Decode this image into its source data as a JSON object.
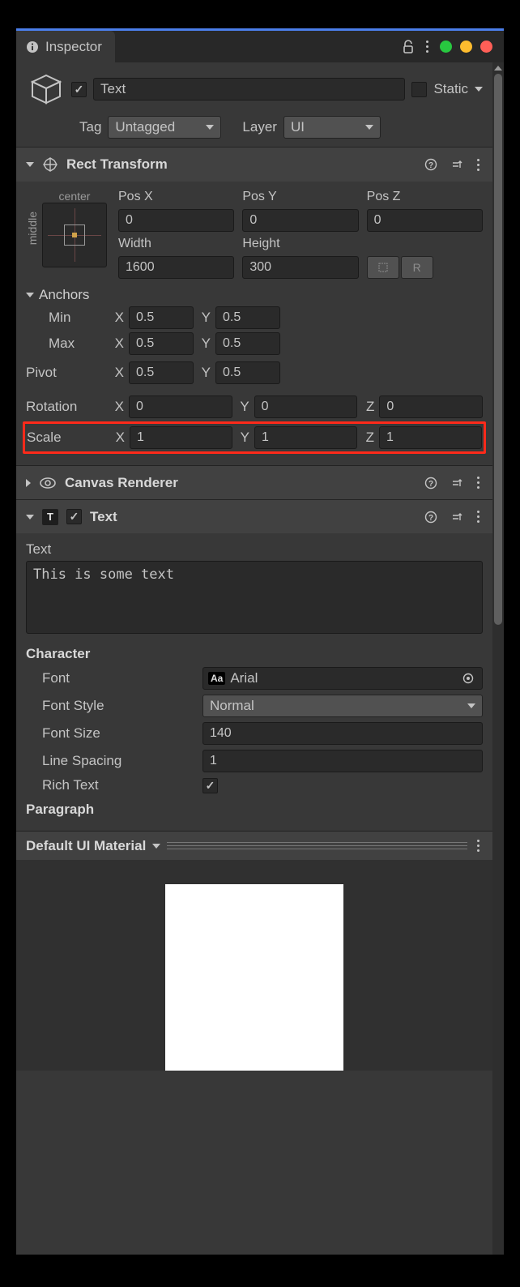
{
  "tab": {
    "title": "Inspector"
  },
  "traffic": {
    "green": "#28c840",
    "yellow": "#febc2e",
    "red": "#ff5f57"
  },
  "go": {
    "active": true,
    "name": "Text",
    "static_label": "Static",
    "tag_label": "Tag",
    "tag_value": "Untagged",
    "layer_label": "Layer",
    "layer_value": "UI"
  },
  "rect": {
    "title": "Rect Transform",
    "anchor_top": "center",
    "anchor_side": "middle",
    "posx_l": "Pos X",
    "posy_l": "Pos Y",
    "posz_l": "Pos Z",
    "posx": "0",
    "posy": "0",
    "posz": "0",
    "width_l": "Width",
    "height_l": "Height",
    "width": "1600",
    "height": "300",
    "btn_blueprint": "⛶",
    "btn_raw": "R",
    "anchors_l": "Anchors",
    "min_l": "Min",
    "max_l": "Max",
    "min_x": "0.5",
    "min_y": "0.5",
    "max_x": "0.5",
    "max_y": "0.5",
    "pivot_l": "Pivot",
    "pivot_x": "0.5",
    "pivot_y": "0.5",
    "rot_l": "Rotation",
    "rot_x": "0",
    "rot_y": "0",
    "rot_z": "0",
    "scale_l": "Scale",
    "scale_x": "1",
    "scale_y": "1",
    "scale_z": "1",
    "x_l": "X",
    "y_l": "Y",
    "z_l": "Z"
  },
  "canvas_renderer": {
    "title": "Canvas Renderer"
  },
  "text": {
    "title": "Text",
    "text_l": "Text",
    "text_value": "This is some text",
    "character_l": "Character",
    "font_l": "Font",
    "font_value": "Arial",
    "fontstyle_l": "Font Style",
    "fontstyle_value": "Normal",
    "fontsize_l": "Font Size",
    "fontsize_value": "140",
    "linespacing_l": "Line Spacing",
    "linespacing_value": "1",
    "richtext_l": "Rich Text",
    "richtext_value": true,
    "paragraph_l": "Paragraph"
  },
  "material": {
    "label": "Default UI Material"
  }
}
